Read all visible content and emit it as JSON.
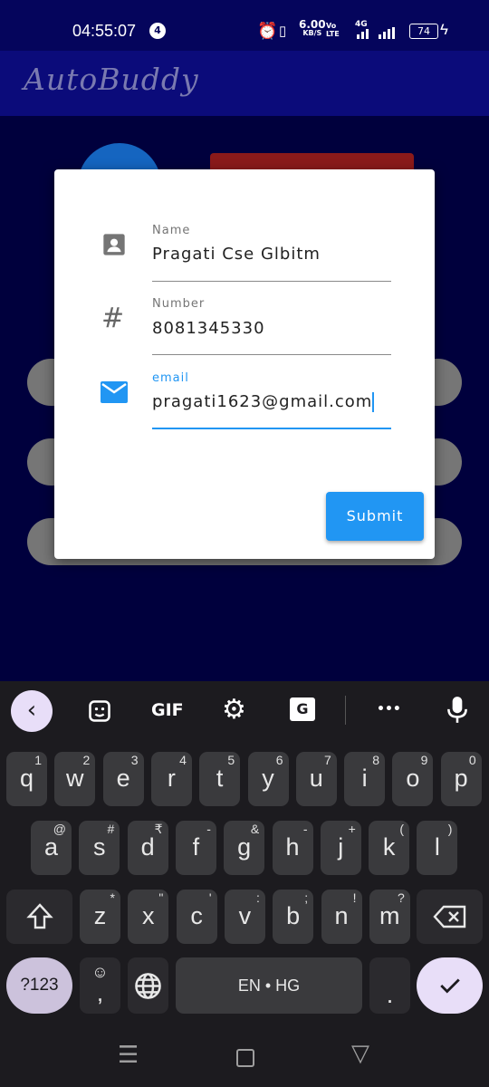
{
  "status_bar": {
    "time": "04:55:07",
    "notif_count": "4",
    "speed_value": "6.00",
    "speed_unit": "KB/S",
    "volte": "Vo LTE",
    "network": "4G",
    "battery": "74"
  },
  "app": {
    "title": "AutoBuddy"
  },
  "dialog": {
    "name_label": "Name",
    "name_value": "Pragati Cse Glbitm",
    "number_label": "Number",
    "number_value": "8081345330",
    "email_label": "email",
    "email_value": "pragati1623@gmail.com",
    "submit_label": "Submit"
  },
  "keyboard": {
    "toolbar": {
      "gif": "GIF",
      "more": "•••"
    },
    "row1": [
      {
        "k": "q",
        "h": "1"
      },
      {
        "k": "w",
        "h": "2"
      },
      {
        "k": "e",
        "h": "3"
      },
      {
        "k": "r",
        "h": "4"
      },
      {
        "k": "t",
        "h": "5"
      },
      {
        "k": "y",
        "h": "6"
      },
      {
        "k": "u",
        "h": "7"
      },
      {
        "k": "i",
        "h": "8"
      },
      {
        "k": "o",
        "h": "9"
      },
      {
        "k": "p",
        "h": "0"
      }
    ],
    "row2": [
      {
        "k": "a",
        "h": "@"
      },
      {
        "k": "s",
        "h": "#"
      },
      {
        "k": "d",
        "h": "₹"
      },
      {
        "k": "f",
        "h": "-"
      },
      {
        "k": "g",
        "h": "&"
      },
      {
        "k": "h",
        "h": "-"
      },
      {
        "k": "j",
        "h": "+"
      },
      {
        "k": "k",
        "h": "("
      },
      {
        "k": "l",
        "h": ")"
      }
    ],
    "row3": [
      {
        "k": "z",
        "h": "*"
      },
      {
        "k": "x",
        "h": "\""
      },
      {
        "k": "c",
        "h": "'"
      },
      {
        "k": "v",
        "h": ":"
      },
      {
        "k": "b",
        "h": ";"
      },
      {
        "k": "n",
        "h": "!"
      },
      {
        "k": "m",
        "h": "?"
      }
    ],
    "symbols_label": "?123",
    "comma_label": ",",
    "space_label": "EN • HG",
    "period_label": "."
  }
}
